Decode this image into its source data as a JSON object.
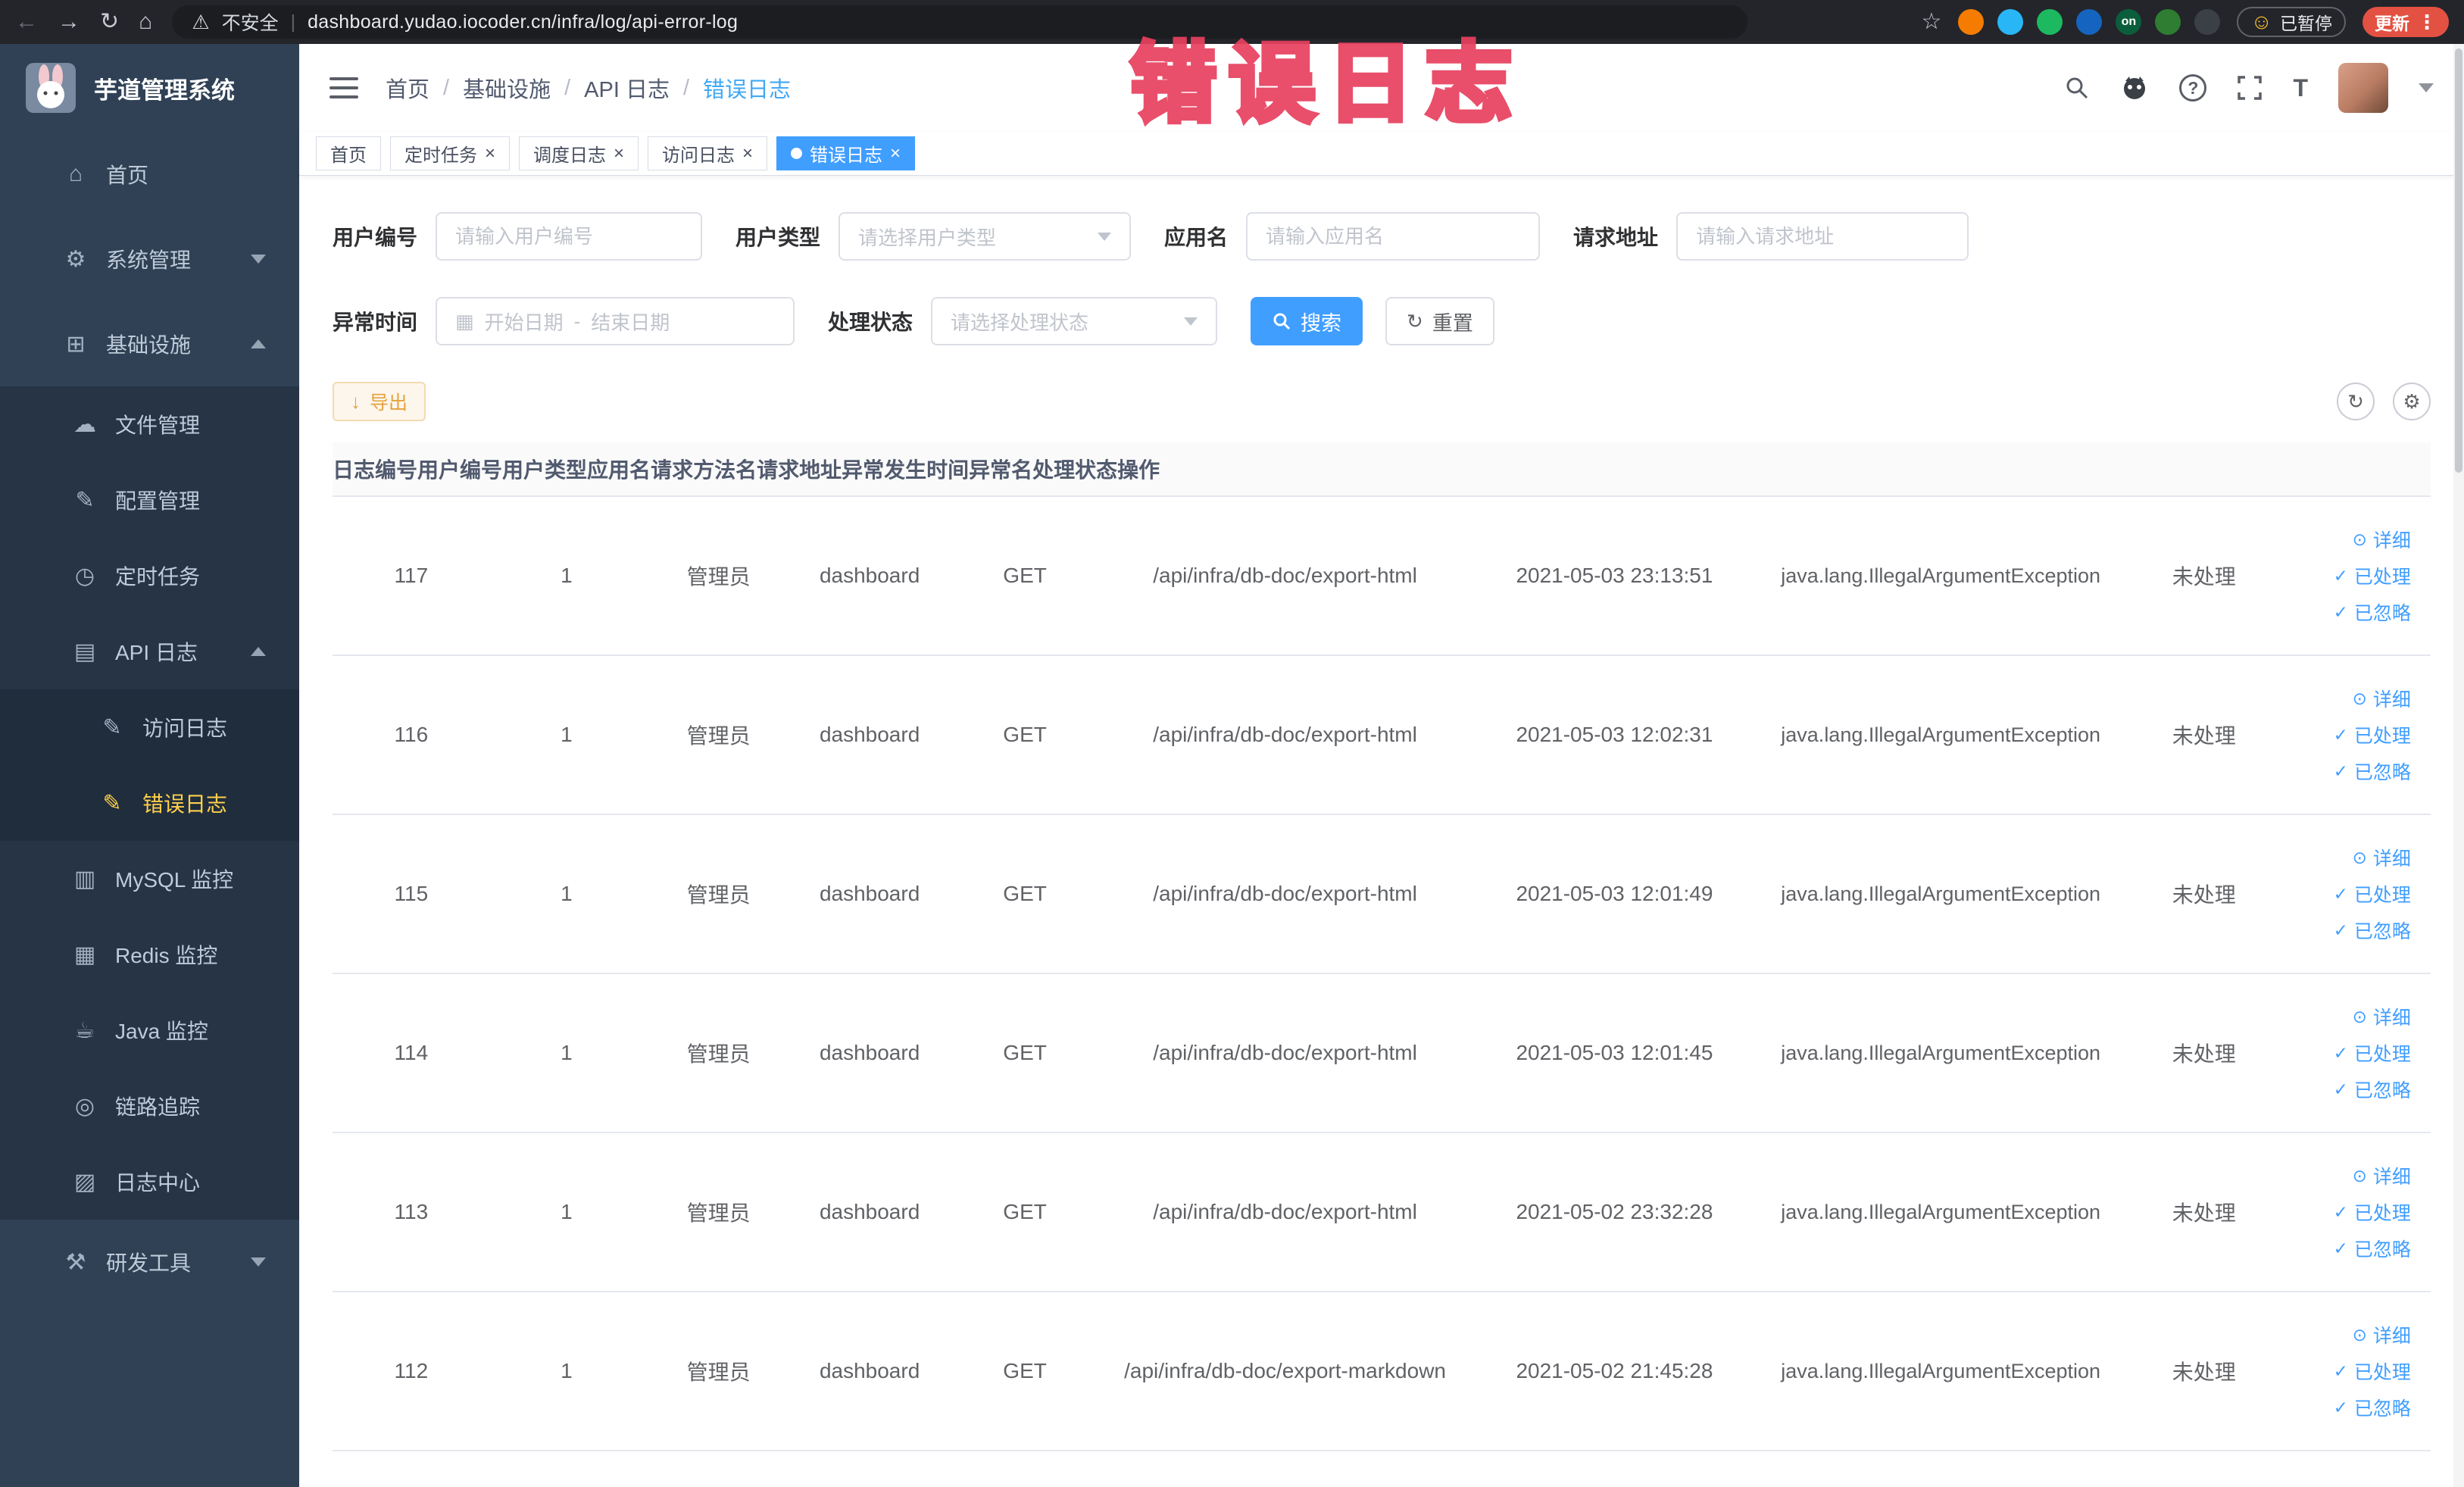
{
  "annotation": {
    "overlay_text": "错误日志"
  },
  "icons": {
    "back": "←",
    "forward": "→",
    "reload": "↻",
    "home": "⌂",
    "warning": "⚠",
    "star": "☆",
    "dots": "⋮",
    "divider": "|",
    "help": "?",
    "font_size": "T",
    "calendar": "▦",
    "download": "↓",
    "refresh": "↻",
    "settings": "⚙",
    "eye": "⊙",
    "check": "✓",
    "smiley": "☺",
    "close": "×",
    "slash": "/",
    "range_sep": "-"
  },
  "browser": {
    "security_label": "不安全",
    "url": "dashboard.yudao.iocoder.cn/infra/log/api-error-log",
    "paused_label": "已暂停",
    "update_label": "更新",
    "extensions": [
      {
        "icon_name": "orange-extension-icon",
        "color": "#f57c00",
        "glyph": ""
      },
      {
        "icon_name": "blue-drop-extension-icon",
        "color": "#29b6f6",
        "glyph": ""
      },
      {
        "icon_name": "green-circle-extension-icon",
        "color": "#1db960",
        "glyph": ""
      },
      {
        "icon_name": "blue-grid-extension-icon",
        "color": "#1565c0",
        "glyph": ""
      },
      {
        "icon_name": "on-badge-extension-icon",
        "color": "#0b5e3b",
        "glyph": "on"
      },
      {
        "icon_name": "green-leaf-extension-icon",
        "color": "#2e7d32",
        "glyph": ""
      },
      {
        "icon_name": "dark-paw-extension-icon",
        "color": "#3a4045",
        "glyph": ""
      }
    ]
  },
  "sidebar": {
    "logo_title": "芋道管理系统",
    "items": [
      {
        "label": "首页",
        "cls": "lvl1",
        "icon": "⌂",
        "icon_name": "home-icon"
      },
      {
        "label": "系统管理",
        "cls": "lvl1",
        "icon": "⚙",
        "icon_name": "system-manage-icon",
        "arrow": "down"
      },
      {
        "label": "基础设施",
        "cls": "lvl1",
        "icon": "⊞",
        "icon_name": "infrastructure-icon",
        "arrow": "up"
      },
      {
        "label": "文件管理",
        "cls": "lvl2",
        "icon": "☁",
        "icon_name": "file-manage-icon"
      },
      {
        "label": "配置管理",
        "cls": "lvl2",
        "icon": "✎",
        "icon_name": "config-manage-icon"
      },
      {
        "label": "定时任务",
        "cls": "lvl2",
        "icon": "◷",
        "icon_name": "scheduled-task-icon"
      },
      {
        "label": "API 日志",
        "cls": "lvl2",
        "icon": "▤",
        "icon_name": "api-log-icon",
        "arrow": "up"
      },
      {
        "label": "访问日志",
        "cls": "lvl3",
        "icon": "✎",
        "icon_name": "access-log-icon"
      },
      {
        "label": "错误日志",
        "cls": "lvl3 active",
        "icon": "✎",
        "icon_name": "error-log-icon"
      },
      {
        "label": "MySQL 监控",
        "cls": "lvl2",
        "icon": "▥",
        "icon_name": "mysql-monitor-icon"
      },
      {
        "label": "Redis 监控",
        "cls": "lvl2",
        "icon": "▦",
        "icon_name": "redis-monitor-icon"
      },
      {
        "label": "Java 监控",
        "cls": "lvl2",
        "icon": "☕",
        "icon_name": "java-monitor-icon"
      },
      {
        "label": "链路追踪",
        "cls": "lvl2",
        "icon": "◎",
        "icon_name": "trace-icon"
      },
      {
        "label": "日志中心",
        "cls": "lvl2",
        "icon": "▨",
        "icon_name": "log-center-icon"
      },
      {
        "label": "研发工具",
        "cls": "lvl1",
        "icon": "⚒",
        "icon_name": "dev-tools-icon",
        "arrow": "down"
      }
    ]
  },
  "header": {
    "breadcrumb": [
      "首页",
      "基础设施",
      "API 日志",
      "错误日志"
    ]
  },
  "tabs": [
    {
      "label": "首页"
    },
    {
      "label": "定时任务",
      "closable": true
    },
    {
      "label": "调度日志",
      "closable": true
    },
    {
      "label": "访问日志",
      "closable": true
    },
    {
      "label": "错误日志",
      "closable": true,
      "active": true,
      "active_cls": "active"
    }
  ],
  "filters": {
    "user_id": {
      "label": "用户编号",
      "placeholder": "请输入用户编号"
    },
    "user_type": {
      "label": "用户类型",
      "placeholder": "请选择用户类型"
    },
    "app_name": {
      "label": "应用名",
      "placeholder": "请输入应用名"
    },
    "request_url": {
      "label": "请求地址",
      "placeholder": "请输入请求地址"
    },
    "exception_time": {
      "label": "异常时间",
      "start_placeholder": "开始日期",
      "end_placeholder": "结束日期"
    },
    "process_status": {
      "label": "处理状态",
      "placeholder": "请选择处理状态"
    },
    "search_label": "搜索",
    "reset_label": "重置"
  },
  "toolbar": {
    "export_label": "导出"
  },
  "table": {
    "columns": [
      "日志编号",
      "用户编号",
      "用户类型",
      "应用名",
      "请求方法名",
      "请求地址",
      "异常发生时间",
      "异常名",
      "处理状态",
      "操作"
    ],
    "actions": [
      "详细",
      "已处理",
      "已忽略"
    ],
    "rows": [
      {
        "log_id": "117",
        "user_id": "1",
        "user_type": "管理员",
        "app_name": "dashboard",
        "method": "GET",
        "url": "/api/infra/db-doc/export-html",
        "time": "2021-05-03 23:13:51",
        "exception": "java.lang.IllegalArgumentException",
        "status": "未处理"
      },
      {
        "log_id": "116",
        "user_id": "1",
        "user_type": "管理员",
        "app_name": "dashboard",
        "method": "GET",
        "url": "/api/infra/db-doc/export-html",
        "time": "2021-05-03 12:02:31",
        "exception": "java.lang.IllegalArgumentException",
        "status": "未处理"
      },
      {
        "log_id": "115",
        "user_id": "1",
        "user_type": "管理员",
        "app_name": "dashboard",
        "method": "GET",
        "url": "/api/infra/db-doc/export-html",
        "time": "2021-05-03 12:01:49",
        "exception": "java.lang.IllegalArgumentException",
        "status": "未处理"
      },
      {
        "log_id": "114",
        "user_id": "1",
        "user_type": "管理员",
        "app_name": "dashboard",
        "method": "GET",
        "url": "/api/infra/db-doc/export-html",
        "time": "2021-05-03 12:01:45",
        "exception": "java.lang.IllegalArgumentException",
        "status": "未处理"
      },
      {
        "log_id": "113",
        "user_id": "1",
        "user_type": "管理员",
        "app_name": "dashboard",
        "method": "GET",
        "url": "/api/infra/db-doc/export-html",
        "time": "2021-05-02 23:32:28",
        "exception": "java.lang.IllegalArgumentException",
        "status": "未处理"
      },
      {
        "log_id": "112",
        "user_id": "1",
        "user_type": "管理员",
        "app_name": "dashboard",
        "method": "GET",
        "url": "/api/infra/db-doc/export-markdown",
        "time": "2021-05-02 21:45:28",
        "exception": "java.lang.IllegalArgumentException",
        "status": "未处理"
      }
    ]
  },
  "colors": {
    "accent": "#409eff",
    "sidebar_active": "#ffd04b",
    "warning": "#e6a23c",
    "annotation": "#e8405e"
  }
}
